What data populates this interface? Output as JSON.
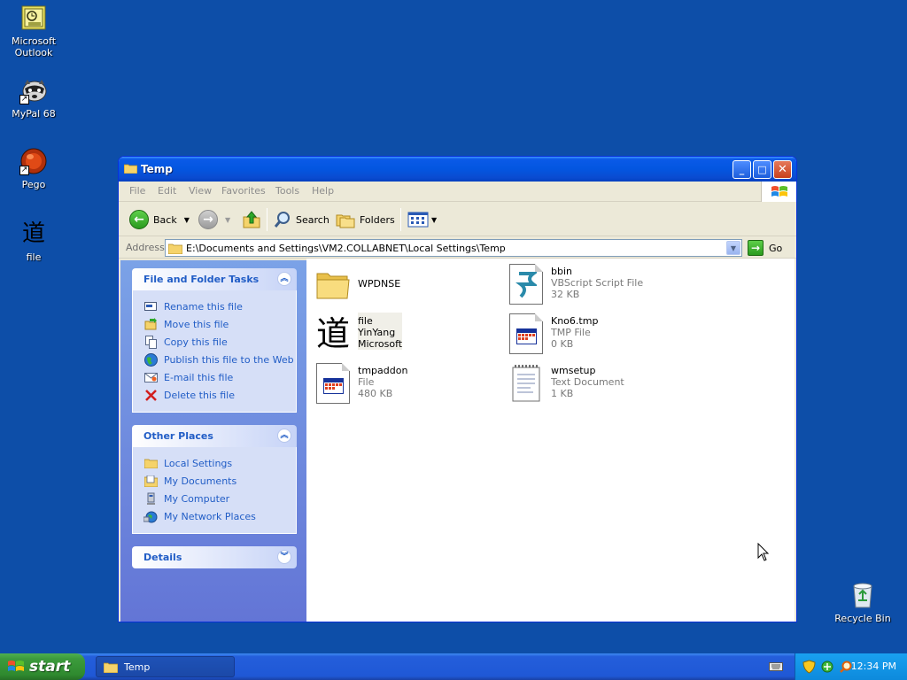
{
  "desktop_icons": [
    {
      "label": "Microsoft Outlook",
      "icon": "outlook-icon"
    },
    {
      "label": "MyPal 68",
      "icon": "mypal-raccoon-icon"
    },
    {
      "label": "Pego",
      "icon": "pego-icon"
    },
    {
      "label": "file",
      "icon": "yinyang-character-icon"
    },
    {
      "label": "Recycle Bin",
      "icon": "recycle-bin-icon"
    }
  ],
  "window": {
    "title": "Temp",
    "menu": [
      "File",
      "Edit",
      "View",
      "Favorites",
      "Tools",
      "Help"
    ],
    "toolbar": {
      "back": "Back",
      "search": "Search",
      "folders": "Folders"
    },
    "address": {
      "label": "Address",
      "value": "E:\\Documents and Settings\\VM2.COLLABNET\\Local Settings\\Temp",
      "go": "Go"
    }
  },
  "task_pane": {
    "file_tasks": {
      "title": "File and Folder Tasks",
      "items": [
        "Rename this file",
        "Move this file",
        "Copy this file",
        "Publish this file to the Web",
        "E-mail this file",
        "Delete this file"
      ]
    },
    "other_places": {
      "title": "Other Places",
      "items": [
        "Local Settings",
        "My Documents",
        "My Computer",
        "My Network Places"
      ]
    },
    "details": {
      "title": "Details"
    }
  },
  "files": [
    {
      "name": "WPDNSE",
      "type": "",
      "size": ""
    },
    {
      "name": "bbin",
      "type": "VBScript Script File",
      "size": "32 KB"
    },
    {
      "name": "file",
      "type": "YinYang",
      "size": "Microsoft"
    },
    {
      "name": "Kno6.tmp",
      "type": "TMP File",
      "size": "0 KB"
    },
    {
      "name": "tmpaddon",
      "type": "File",
      "size": "480 KB"
    },
    {
      "name": "wmsetup",
      "type": "Text Document",
      "size": "1 KB"
    }
  ],
  "taskbar": {
    "start": "start",
    "task": "Temp",
    "clock": "12:34 PM"
  }
}
